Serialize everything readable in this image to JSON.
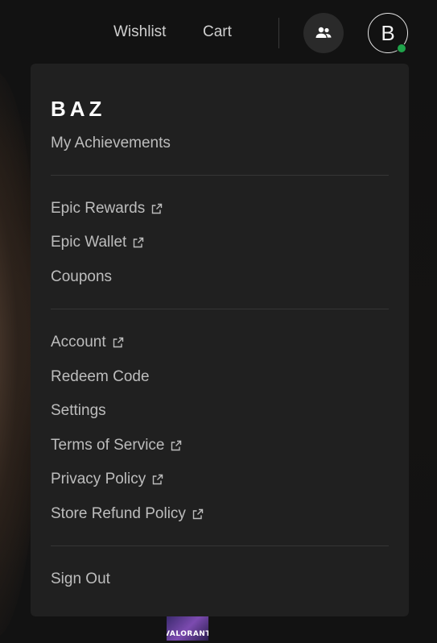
{
  "nav": {
    "wishlist": "Wishlist",
    "cart": "Cart",
    "friends_icon": "friends-icon",
    "avatar_initial": "B",
    "status_color": "#1fa34a"
  },
  "menu": {
    "username": "BAZ",
    "achievements": "My Achievements",
    "rewards": "Epic Rewards",
    "wallet": "Epic Wallet",
    "coupons": "Coupons",
    "account": "Account",
    "redeem": "Redeem Code",
    "settings": "Settings",
    "terms": "Terms of Service",
    "privacy": "Privacy Policy",
    "refund": "Store Refund Policy",
    "signout": "Sign Out",
    "external_icon": "external-link-icon"
  },
  "background": {
    "game_thumbnail_label": "VALORANT"
  }
}
